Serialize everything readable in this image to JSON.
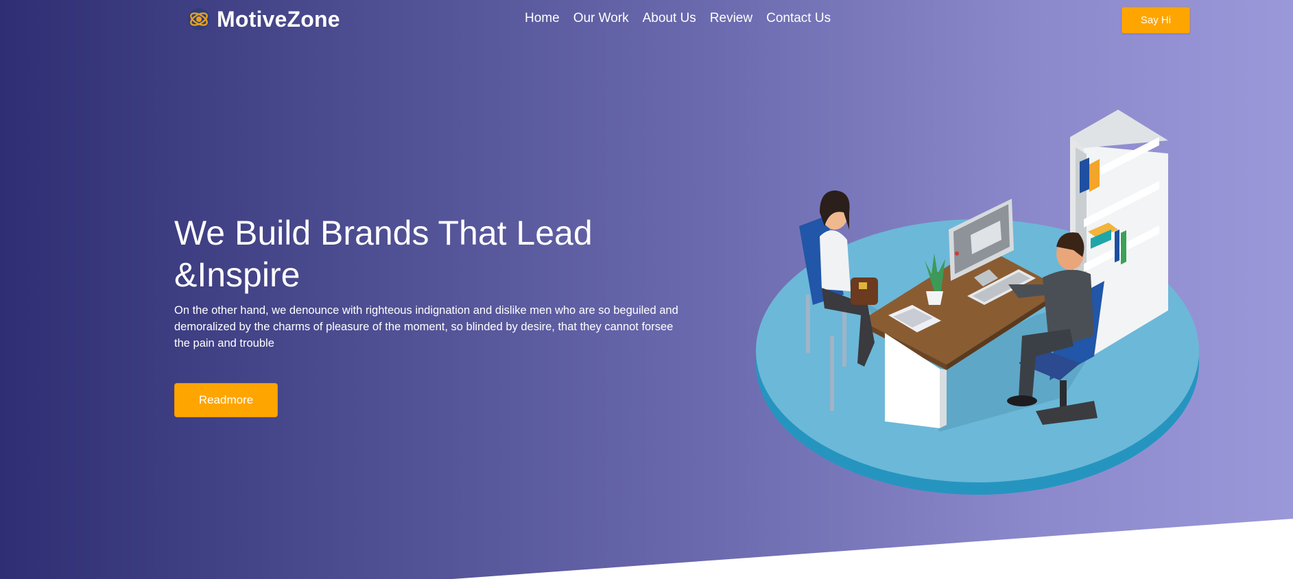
{
  "brand": {
    "name": "MotiveZone",
    "logo_icon": "eye-orbit-icon",
    "accent_color": "#ffa500"
  },
  "nav": {
    "items": [
      {
        "label": "Home"
      },
      {
        "label": "Our Work"
      },
      {
        "label": "About Us"
      },
      {
        "label": "Review"
      },
      {
        "label": "Contact Us"
      }
    ],
    "cta_label": "Say Hi"
  },
  "hero": {
    "title": "We Build Brands That Lead &Inspire",
    "description": "On the other hand, we denounce with righteous indignation and dislike men who are so beguiled and demoralized by the charms of pleasure of the moment, so blinded by desire, that they cannot forsee the pain and trouble",
    "button_label": "Readmore",
    "illustration": "office-meeting-illustration"
  },
  "colors": {
    "gradient_start": "#2f2e74",
    "gradient_end": "#9b98da",
    "platform": "#6cb8d8",
    "platform_edge": "#2595c0"
  }
}
